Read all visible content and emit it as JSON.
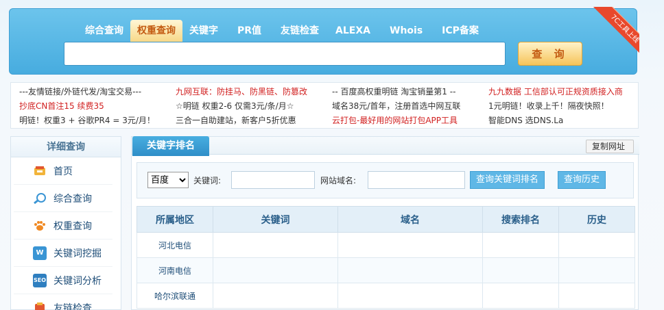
{
  "nav": {
    "items": [
      {
        "label": "综合查询",
        "active": false
      },
      {
        "label": "权重查询",
        "active": true
      },
      {
        "label": "关键字",
        "active": false
      },
      {
        "label": "PR值",
        "active": false
      },
      {
        "label": "友链检查",
        "active": false
      },
      {
        "label": "ALEXA",
        "active": false
      },
      {
        "label": "Whois",
        "active": false
      },
      {
        "label": "ICP备案",
        "active": false
      }
    ],
    "search_value": "",
    "search_button": "查 询",
    "ribbon": "7C工具上线"
  },
  "ads": {
    "col1": [
      "---友情链接/外链代发/淘宝交易---",
      "抄底CN首注15 续费35",
      "明链！权重3 + 谷歌PR4 = 3元/月！"
    ],
    "col2": [
      "九网互联：防挂马、防黑链、防篡改",
      "☆明链 权重2-6 仅需3元/条/月☆",
      "三合一自助建站，新客户5折优惠"
    ],
    "col3": [
      "-- 百度高权重明链 淘宝销量第1 --",
      "域名38元/首年，注册首选中网互联",
      "云打包-最好用的网站打包APP工具"
    ],
    "col4": [
      "九九数据 工信部认可正规资质接入商",
      "1元明链！收录上千！隔夜快照！",
      "智能DNS 选DNS.La"
    ]
  },
  "sidebar": {
    "title": "详细查询",
    "items": [
      {
        "label": "首页",
        "icon": "home-icon"
      },
      {
        "label": "综合查询",
        "icon": "magnifier-icon"
      },
      {
        "label": "权重查询",
        "icon": "paw-icon"
      },
      {
        "label": "关键词挖掘",
        "icon": "w-icon"
      },
      {
        "label": "关键词分析",
        "icon": "seo-icon"
      },
      {
        "label": "友链检查",
        "icon": "link-icon"
      }
    ]
  },
  "main": {
    "tab": "关键字排名",
    "copy_button": "复制网址",
    "engine": "百度",
    "engine_options": [
      "百度"
    ],
    "keyword_label": "关键词:",
    "keyword_value": "",
    "domain_label": "网站域名:",
    "domain_value": "",
    "query_button": "查询关键词排名",
    "history_button": "查询历史",
    "table": {
      "headers": [
        "所属地区",
        "关键词",
        "域名",
        "搜索排名",
        "历史"
      ],
      "rows": [
        [
          "河北电信",
          "",
          "",
          "",
          ""
        ],
        [
          "河南电信",
          "",
          "",
          "",
          ""
        ],
        [
          "哈尔滨联通",
          "",
          "",
          "",
          ""
        ]
      ]
    }
  },
  "colors": {
    "accent_blue": "#47acdf",
    "active_tab_text": "#c35b12",
    "ad_red": "#d11f1f"
  }
}
